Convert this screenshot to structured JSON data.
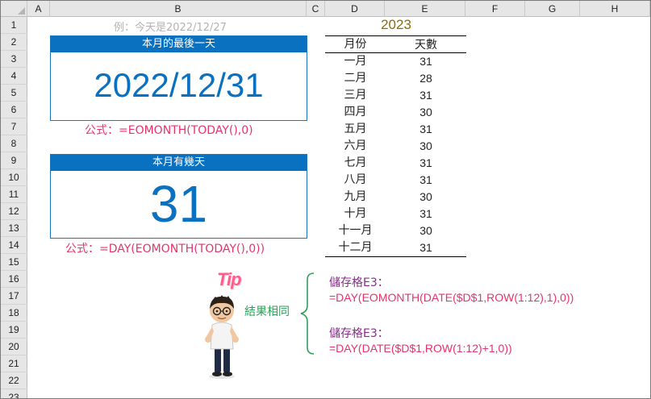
{
  "columns": [
    "A",
    "B",
    "C",
    "D",
    "E",
    "F",
    "G",
    "H"
  ],
  "rows": [
    "1",
    "2",
    "3",
    "4",
    "5",
    "6",
    "7",
    "8",
    "9",
    "10",
    "11",
    "12",
    "13",
    "14",
    "15",
    "16",
    "17",
    "18",
    "19",
    "20",
    "21",
    "22",
    "23"
  ],
  "note": "例：今天是2022/12/27",
  "card1": {
    "header": "本月的最後一天",
    "value": "2022/12/31"
  },
  "formula1": "公式：=EOMONTH(TODAY(),0)",
  "card2": {
    "header": "本月有幾天",
    "value": "31"
  },
  "formula2": "公式：=DAY(EOMONTH(TODAY(),0))",
  "year": "2023",
  "table": {
    "headers": [
      "月份",
      "天數"
    ],
    "rows": [
      [
        "一月",
        "31"
      ],
      [
        "二月",
        "28"
      ],
      [
        "三月",
        "31"
      ],
      [
        "四月",
        "30"
      ],
      [
        "五月",
        "31"
      ],
      [
        "六月",
        "30"
      ],
      [
        "七月",
        "31"
      ],
      [
        "八月",
        "31"
      ],
      [
        "九月",
        "30"
      ],
      [
        "十月",
        "31"
      ],
      [
        "十一月",
        "30"
      ],
      [
        "十二月",
        "31"
      ]
    ]
  },
  "tip": {
    "badge": "Tip",
    "same_result": "結果相同",
    "label1": "儲存格E3：",
    "formula1": "=DAY(EOMONTH(DATE($D$1,ROW(1:12),1),0))",
    "label2": "儲存格E3：",
    "formula2": "=DAY(DATE($D$1,ROW(1:12)+1,0))"
  },
  "colors": {
    "accent": "#0a70c0",
    "formula": "#e8336a",
    "year": "#8a6d0b",
    "label": "#8a2b8c",
    "same": "#2fa05a"
  }
}
